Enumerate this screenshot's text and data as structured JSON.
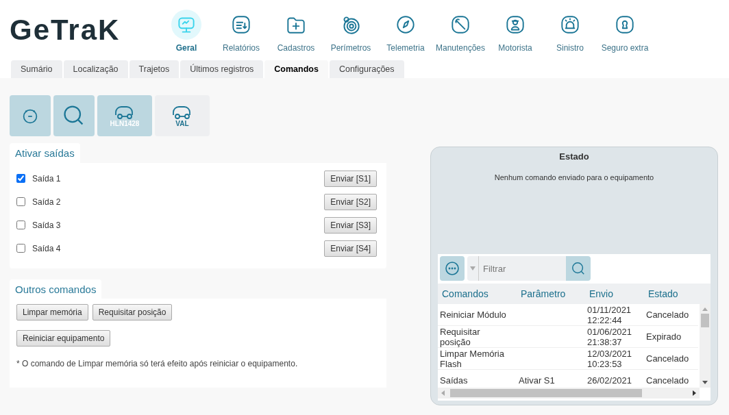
{
  "logo": "GeTraK",
  "nav": [
    {
      "label": "Geral",
      "selected": true
    },
    {
      "label": "Relatórios",
      "selected": false
    },
    {
      "label": "Cadastros",
      "selected": false
    },
    {
      "label": "Perímetros",
      "selected": false
    },
    {
      "label": "Telemetria",
      "selected": false
    },
    {
      "label": "Manutenções",
      "selected": false
    },
    {
      "label": "Motorista",
      "selected": false
    },
    {
      "label": "Sinistro",
      "selected": false
    },
    {
      "label": "Seguro extra",
      "selected": false
    }
  ],
  "tabs": [
    {
      "label": "Sumário",
      "selected": false
    },
    {
      "label": "Localização",
      "selected": false
    },
    {
      "label": "Trajetos",
      "selected": false
    },
    {
      "label": "Últimos registros",
      "selected": false
    },
    {
      "label": "Comandos",
      "selected": true
    },
    {
      "label": "Configurações",
      "selected": false
    }
  ],
  "toolbar": [
    {
      "kind": "clock",
      "selected": true
    },
    {
      "kind": "search",
      "selected": true
    },
    {
      "kind": "vehicle",
      "label": "HLN1428",
      "selected": true
    },
    {
      "kind": "vehicle",
      "label": "VAL",
      "selected": false
    }
  ],
  "outputs": {
    "title": "Ativar saídas",
    "items": [
      {
        "label": "Saída 1",
        "checked": true,
        "button": "Enviar [S1]"
      },
      {
        "label": "Saída 2",
        "checked": false,
        "button": "Enviar [S2]"
      },
      {
        "label": "Saída 3",
        "checked": false,
        "button": "Enviar [S3]"
      },
      {
        "label": "Saída 4",
        "checked": false,
        "button": "Enviar [S4]"
      }
    ]
  },
  "other": {
    "title": "Outros comandos",
    "buttons": [
      "Limpar memória",
      "Requisitar posição",
      "Reiniciar equipamento"
    ],
    "note": "* O comando de Limpar memória só terá efeito após reiniciar o equipamento."
  },
  "status": {
    "title": "Estado",
    "message": "Nenhum comando enviado para o equipamento",
    "filter": {
      "placeholder": "Filtrar"
    },
    "columns": [
      "Comandos",
      "Parâmetro",
      "Envio",
      "Estado"
    ],
    "rows": [
      [
        "Reiniciar Módulo",
        "",
        "01/11/2021\n12:22:44",
        "Cancelado"
      ],
      [
        "Requisitar\nposição",
        "",
        "01/06/2021\n21:38:37",
        "Expirado"
      ],
      [
        "Limpar Memória\nFlash",
        "",
        "12/03/2021\n10:23:53",
        "Cancelado"
      ],
      [
        "Saídas",
        "Ativar S1",
        "26/02/2021",
        "Cancelado"
      ]
    ]
  }
}
